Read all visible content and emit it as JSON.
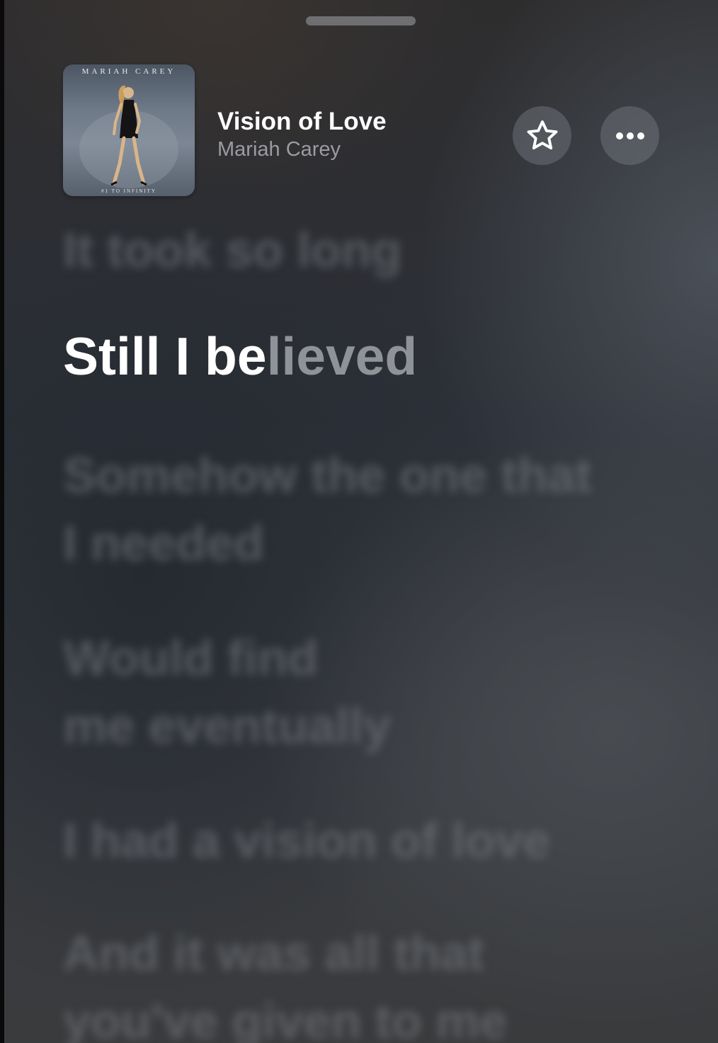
{
  "now_playing": {
    "title": "Vision of Love",
    "artist": "Mariah Carey",
    "album_art": {
      "artist_text": "MARIAH CAREY",
      "footer_text": "#1 TO INFINITY"
    }
  },
  "controls": {
    "favorite_icon": "star-icon",
    "more_icon": "ellipsis-icon"
  },
  "lyrics": {
    "previous": "It took so long",
    "current_sung": "Still I be",
    "current_unsung": "lieved",
    "upcoming": [
      "Somehow the one that",
      "I needed",
      "Would find",
      "me eventually",
      "I had a vision of love",
      "And it was all that",
      "you've given to me"
    ]
  }
}
